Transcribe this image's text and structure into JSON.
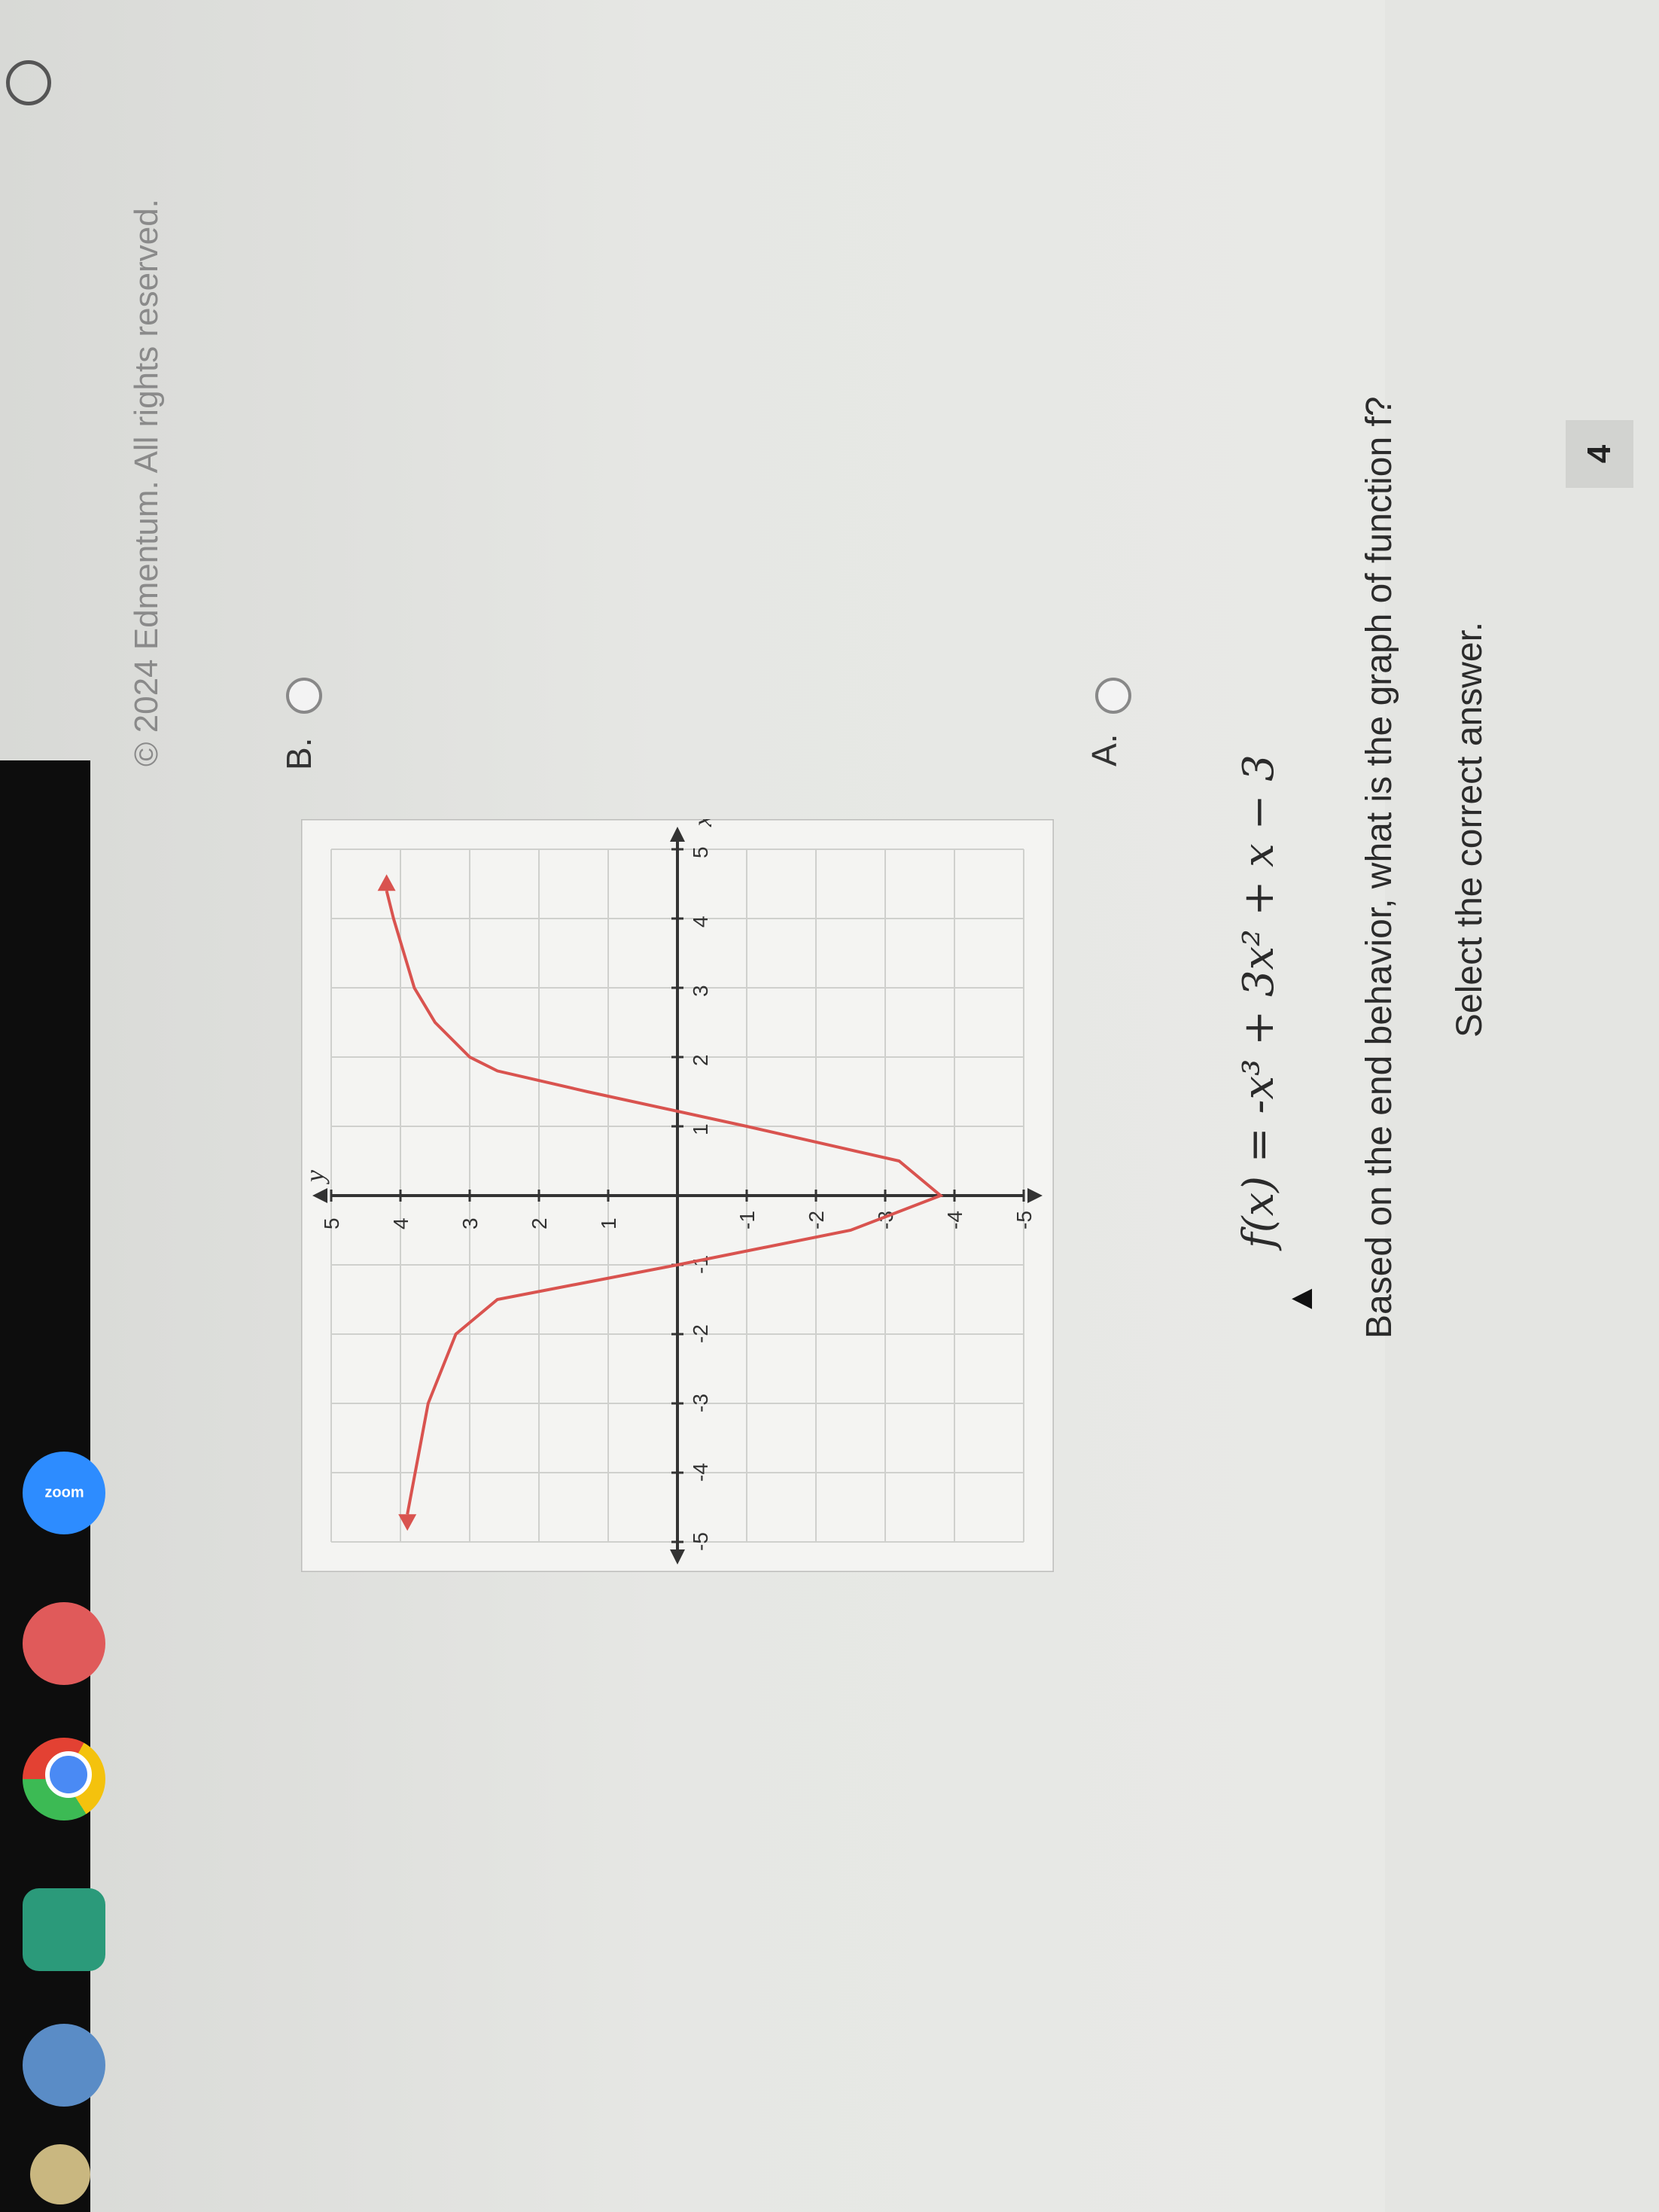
{
  "question": {
    "number": "4",
    "instruction": "Select the correct answer.",
    "prompt": "Based on the end behavior, what is the graph of function f?",
    "function_text": "f(x) = -x³ + 3x² + x − 3"
  },
  "options": {
    "a_label": "A.",
    "b_label": "B."
  },
  "footer": {
    "copyright": "© 2024 Edmentum. All rights reserved."
  },
  "taskbar": {
    "zoom_label": "zoom",
    "icons": [
      "zoom-icon",
      "red-app-icon",
      "chrome-icon",
      "classroom-icon",
      "files-icon",
      "avatar-icon"
    ]
  },
  "chart_data": {
    "type": "line",
    "xlabel": "x",
    "ylabel": "y",
    "xlim": [
      -5,
      5
    ],
    "ylim": [
      -5,
      5
    ],
    "grid": true,
    "x_ticks": [
      "-5",
      "-4",
      "-3",
      "-2",
      "-1",
      "1",
      "2",
      "3",
      "4",
      "5"
    ],
    "y_ticks": [
      "-5",
      "-4",
      "-3",
      "-2",
      "-1",
      "1",
      "2",
      "3",
      "4",
      "5"
    ],
    "series": [
      {
        "color": "#d9534f",
        "x": [
          -4.6,
          -3,
          -2,
          -1.5,
          -1,
          -0.5,
          0,
          0.5,
          1,
          1.5,
          1.8,
          2,
          2.5,
          3,
          4,
          4.4
        ],
        "y": [
          3.9,
          3.6,
          3.2,
          2.6,
          0,
          -2.5,
          -3.8,
          -3.2,
          -1,
          1.3,
          2.6,
          3,
          3.5,
          3.8,
          4.1,
          4.2
        ]
      }
    ],
    "colors": {
      "curve": "#d9534f",
      "axis": "#333333",
      "grid": "#cfd0cd"
    }
  }
}
